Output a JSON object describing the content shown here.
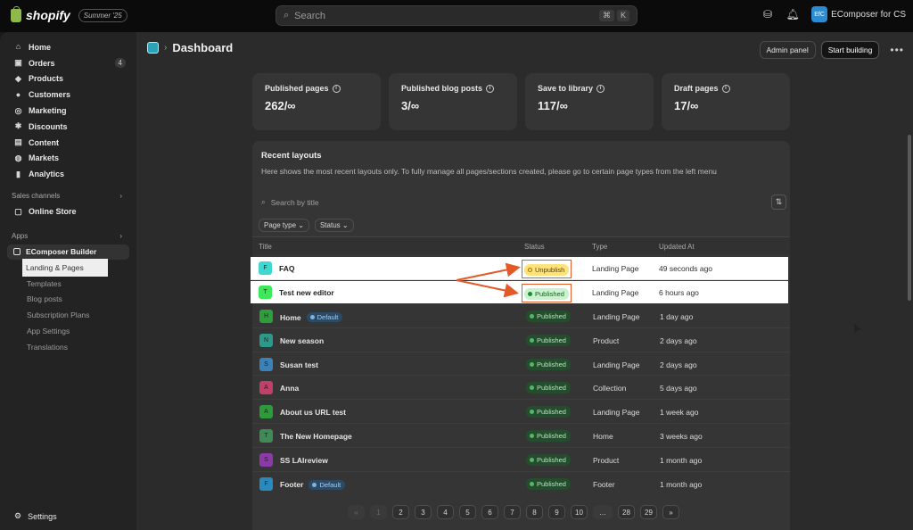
{
  "topbar": {
    "brand": "shopify",
    "edition": "Summer '25",
    "search_placeholder": "Search",
    "kbd": [
      "⌘",
      "K"
    ],
    "store_initials": "EfC",
    "store_name": "EComposer for CS"
  },
  "sidebar": {
    "items": [
      {
        "label": "Home",
        "icon": "home-icon"
      },
      {
        "label": "Orders",
        "icon": "orders-icon",
        "badge": "4"
      },
      {
        "label": "Products",
        "icon": "tag-icon"
      },
      {
        "label": "Customers",
        "icon": "person-icon"
      },
      {
        "label": "Marketing",
        "icon": "target-icon"
      },
      {
        "label": "Discounts",
        "icon": "discount-icon"
      },
      {
        "label": "Content",
        "icon": "content-icon"
      },
      {
        "label": "Markets",
        "icon": "globe-icon"
      },
      {
        "label": "Analytics",
        "icon": "bar-chart-icon"
      }
    ],
    "sales_channels_label": "Sales channels",
    "online_store": "Online Store",
    "apps_label": "Apps",
    "app_name": "EComposer Builder",
    "app_subitems": [
      "Landing & Pages",
      "Templates",
      "Blog posts",
      "Subscription Plans",
      "App Settings",
      "Translations"
    ],
    "settings": "Settings"
  },
  "header": {
    "title": "Dashboard",
    "admin_panel": "Admin panel",
    "start_building": "Start building"
  },
  "stats": [
    {
      "label": "Published pages",
      "value": "262/∞"
    },
    {
      "label": "Published blog posts",
      "value": "3/∞"
    },
    {
      "label": "Save to library",
      "value": "117/∞"
    },
    {
      "label": "Draft pages",
      "value": "17/∞"
    }
  ],
  "recent": {
    "title": "Recent layouts",
    "description": "Here shows the most recent layouts only. To fully manage all pages/sections created, please go to certain page types from the left menu",
    "search_placeholder": "Search by title",
    "filters": [
      "Page type",
      "Status"
    ],
    "columns": [
      "Title",
      "Status",
      "Type",
      "Updated At"
    ],
    "highlighted_rows": [
      {
        "initial": "F",
        "title": "FAQ",
        "status": "Unpublish",
        "type": "Landing Page",
        "updated": "49 seconds ago",
        "color": "#3fd8d0"
      },
      {
        "initial": "T",
        "title": "Test new editor",
        "status": "Published",
        "type": "Landing Page",
        "updated": "6 hours ago",
        "color": "#3ee85a"
      }
    ],
    "rows": [
      {
        "initial": "H",
        "title": "Home",
        "badge": "Default",
        "status": "Published",
        "type": "Landing Page",
        "updated": "1 day ago",
        "color": "#2e9e3c"
      },
      {
        "initial": "N",
        "title": "New season",
        "badge": "",
        "status": "Published",
        "type": "Product",
        "updated": "2 days ago",
        "color": "#2a9a8c"
      },
      {
        "initial": "S",
        "title": "Susan test",
        "badge": "",
        "status": "Published",
        "type": "Landing Page",
        "updated": "2 days ago",
        "color": "#3a82b8"
      },
      {
        "initial": "A",
        "title": "Anna",
        "badge": "",
        "status": "Published",
        "type": "Collection",
        "updated": "5 days ago",
        "color": "#c0406a"
      },
      {
        "initial": "A",
        "title": "About us URL test",
        "badge": "",
        "status": "Published",
        "type": "Landing Page",
        "updated": "1 week ago",
        "color": "#2d9b3a"
      },
      {
        "initial": "T",
        "title": "The New Homepage",
        "badge": "",
        "status": "Published",
        "type": "Home",
        "updated": "3 weeks ago",
        "color": "#3f8a55"
      },
      {
        "initial": "S",
        "title": "SS LAIreview",
        "badge": "",
        "status": "Published",
        "type": "Product",
        "updated": "1 month ago",
        "color": "#8c3aa8"
      },
      {
        "initial": "F",
        "title": "Footer",
        "badge": "Default",
        "status": "Published",
        "type": "Footer",
        "updated": "1 month ago",
        "color": "#2a8ac0"
      }
    ]
  },
  "pagination": {
    "prev": "«",
    "pages": [
      "1",
      "2",
      "3",
      "4",
      "5",
      "6",
      "7",
      "8",
      "9",
      "10"
    ],
    "ellipsis": "…",
    "tail": [
      "28",
      "29"
    ],
    "next": "»"
  },
  "colors": {
    "accent": "#e35a28",
    "published": "#c8f3cd",
    "unpublish": "#ffe27a"
  }
}
